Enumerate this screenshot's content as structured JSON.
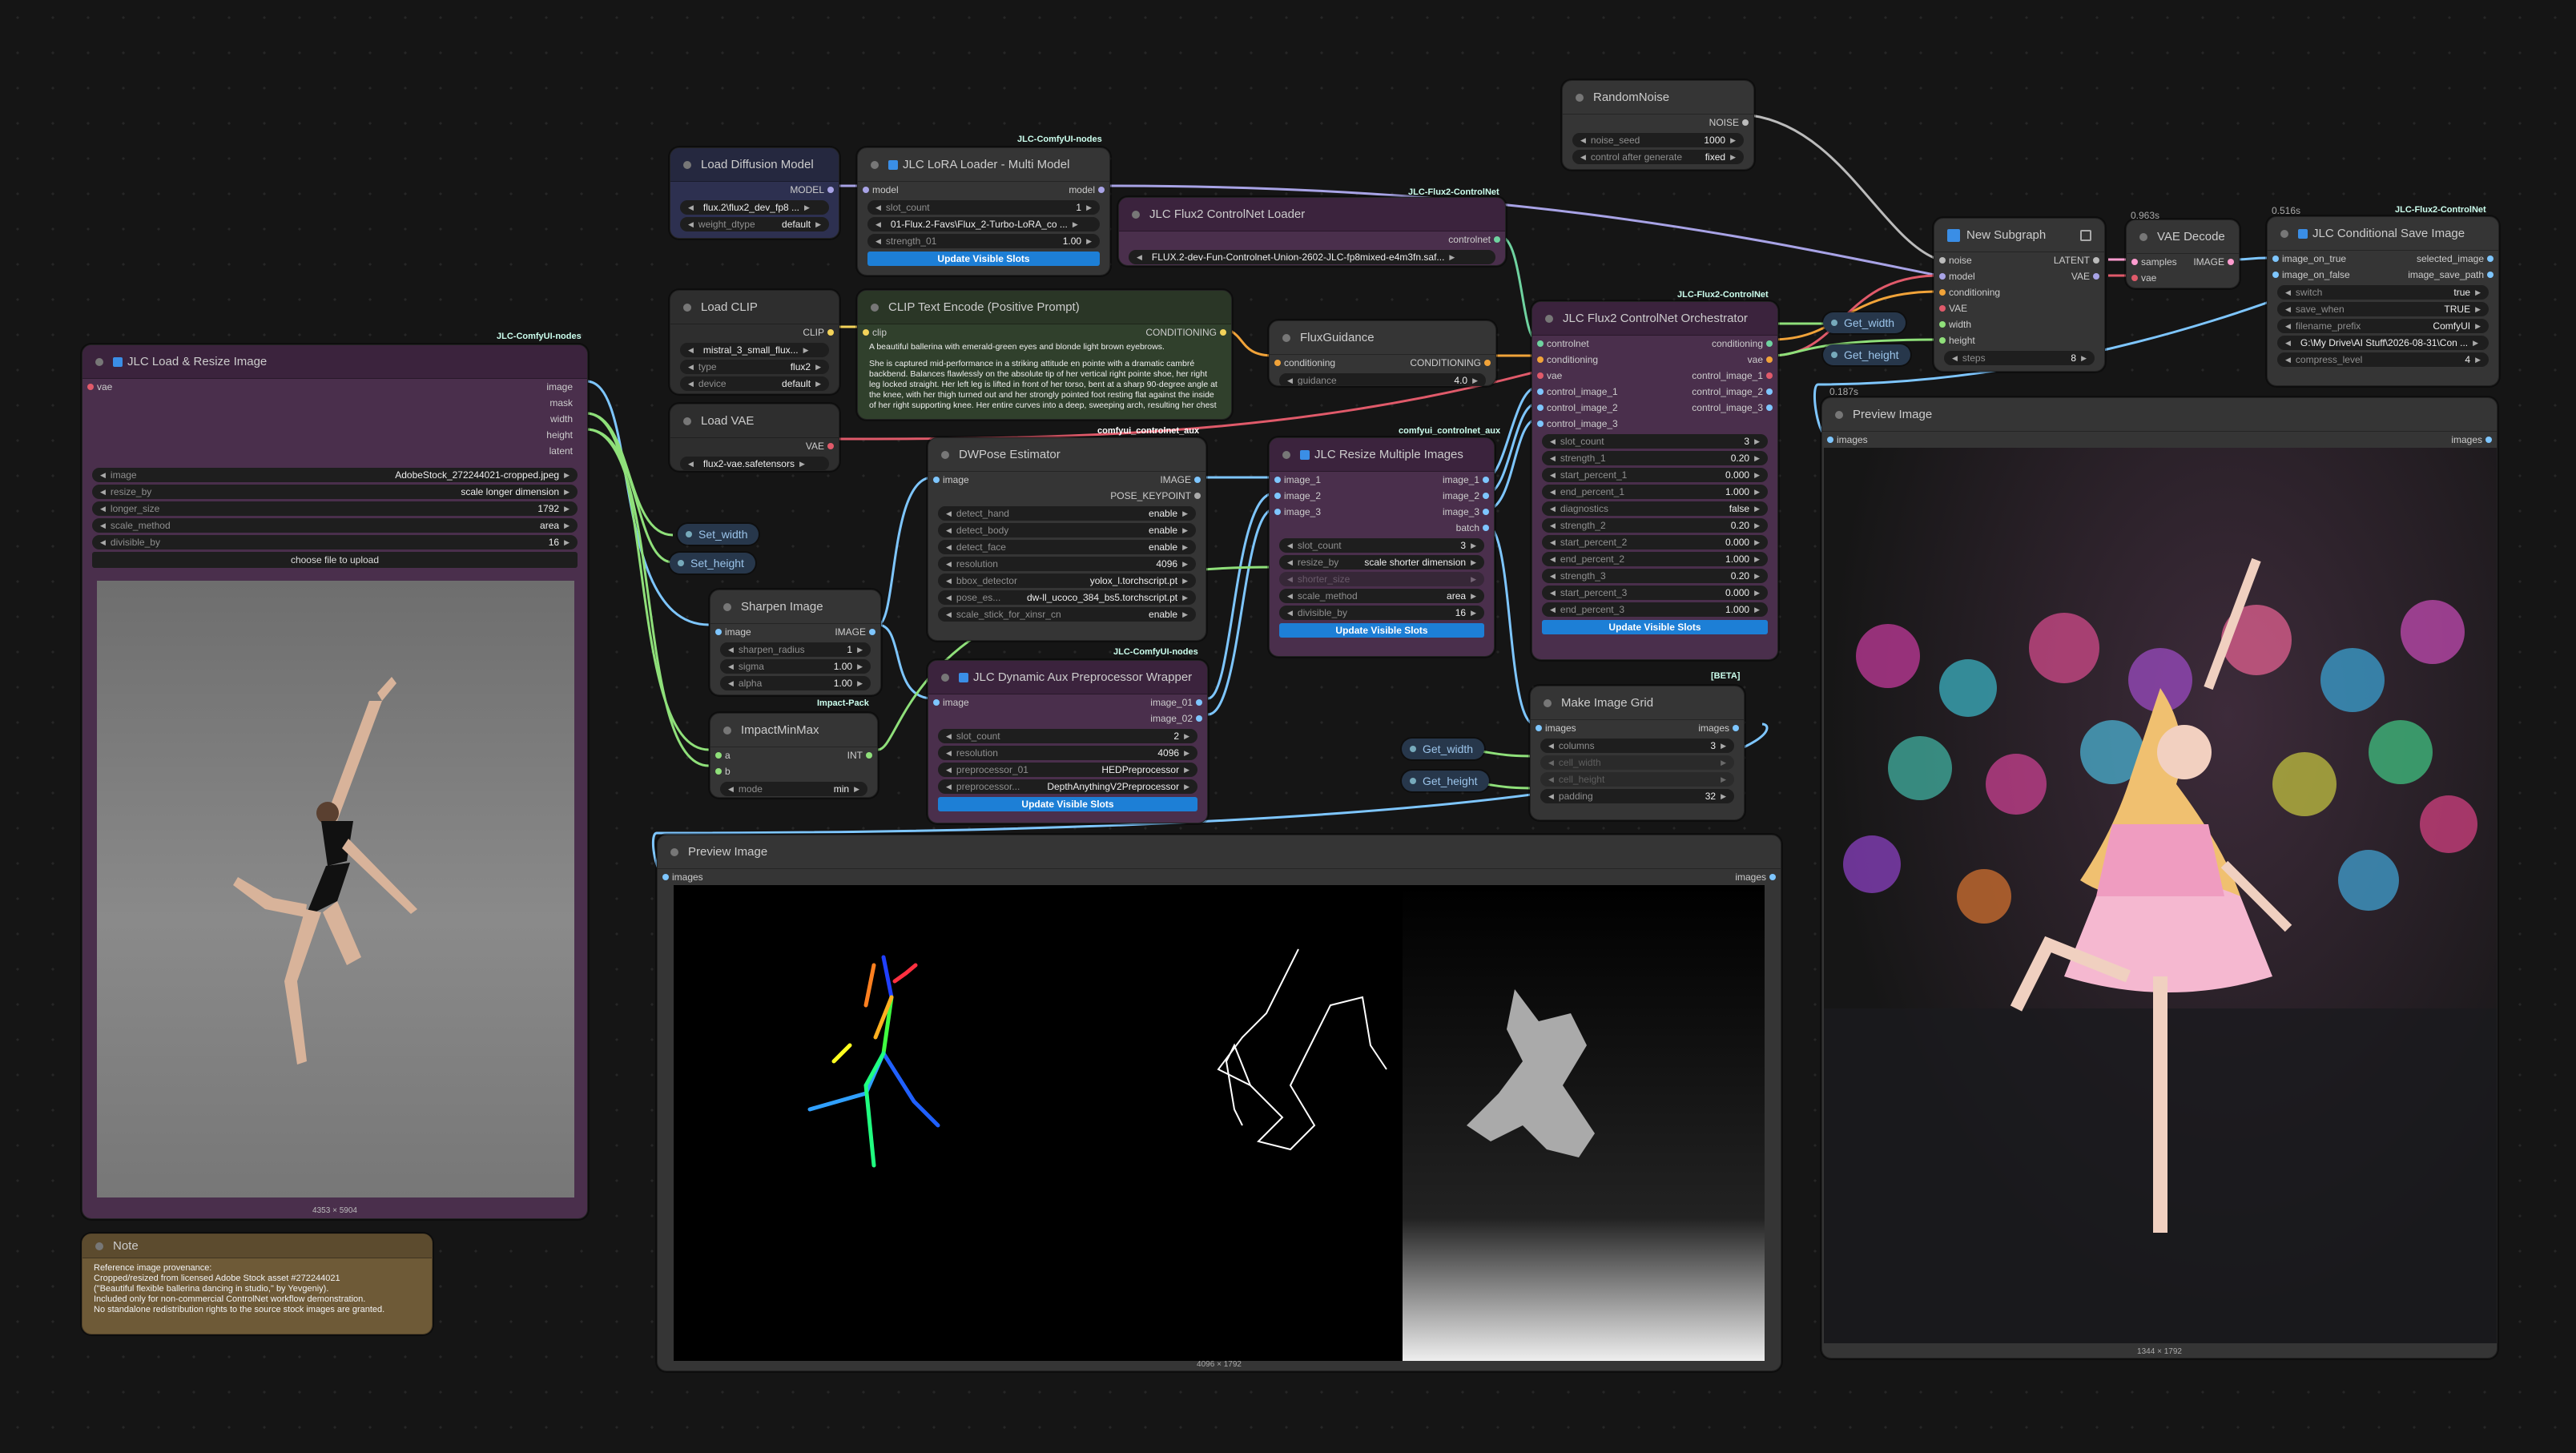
{
  "badges": {
    "jlc_nodes_1": "JLC-ComfyUI-nodes",
    "jlc_nodes_2": "JLC-ComfyUI-nodes",
    "jlc_nodes_3": "JLC-ComfyUI-nodes",
    "flux2_cn_1": "JLC-Flux2-ControlNet",
    "flux2_cn_2": "JLC-Flux2-ControlNet",
    "flux2_cn_3": "JLC-Flux2-ControlNet",
    "aux": "comfyui_controlnet_aux",
    "impact": "Impact-Pack",
    "beta": "[BETA]",
    "t1": "0.963s",
    "t2": "0.516s",
    "t3": "0.187s"
  },
  "load_resize": {
    "title": "JLC Load & Resize Image",
    "input": "vae",
    "outputs": [
      "image",
      "mask",
      "width",
      "height",
      "latent"
    ],
    "image": "AdobeStock_272244021-cropped.jpeg",
    "resize_by": "scale longer dimension",
    "longer_size": "1792",
    "scale_method": "area",
    "divisible_by": "16",
    "upload": "choose file to upload",
    "dims": "4353 × 5904",
    "labels": {
      "image": "image",
      "resize_by": "resize_by",
      "longer_size": "longer_size",
      "scale_method": "scale_method",
      "divisible_by": "divisible_by"
    }
  },
  "note": {
    "title": "Note",
    "lines": [
      "Reference image provenance:",
      "Cropped/resized from licensed Adobe Stock asset #272244021",
      "(\"Beautiful flexible ballerina dancing in studio,\" by Yevgeniy).",
      "Included only for non-commercial ControlNet workflow demonstration.",
      "No standalone redistribution rights to the source stock images are granted."
    ]
  },
  "load_diffusion": {
    "title": "Load Diffusion Model",
    "out": "MODEL",
    "unet_name": "flux.2\\flux2_dev_fp8 ...",
    "weight_dtype_label": "weight_dtype",
    "weight_dtype": "default"
  },
  "lora": {
    "title": "JLC LoRA Loader - Multi Model",
    "in": "model",
    "out": "model",
    "slot_count_label": "slot_count",
    "slot_count": "1",
    "lora": "01-Flux.2-Favs\\Flux_2-Turbo-LoRA_co ...",
    "strength_label": "strength_01",
    "strength": "1.00",
    "button": "Update Visible Slots"
  },
  "load_clip": {
    "title": "Load CLIP",
    "out": "CLIP",
    "clip_name": "mistral_3_small_flux...",
    "type_label": "type",
    "type": "flux2",
    "device_label": "device",
    "device": "default"
  },
  "load_vae": {
    "title": "Load VAE",
    "out": "VAE",
    "vae_name": "flux2-vae.safetensors"
  },
  "clip_text": {
    "title": "CLIP Text Encode (Positive Prompt)",
    "in": "clip",
    "out": "CONDITIONING",
    "text1": "A beautiful ballerina with emerald-green eyes and blonde light brown eyebrows.",
    "text2": "She is captured mid-performance in a striking attitude en pointe with a dramatic cambré backbend. Balances flawlessly on the absolute tip of her vertical right pointe shoe, her right leg locked straight. Her left leg is lifted in front of her torso, bent at a sharp 90-degree angle at the knee, with her thigh turned out and her strongly pointed foot resting flat against the inside of her right supporting knee. Her entire curves into a deep, sweeping arch, resulting her chest upward while body"
  },
  "cn_loader": {
    "title": "JLC Flux2 ControlNet Loader",
    "out": "controlnet",
    "model": "FLUX.2-dev-Fun-Controlnet-Union-2602-JLC-fp8mixed-e4m3fn.saf..."
  },
  "flux_guidance": {
    "title": "FluxGuidance",
    "in": "conditioning",
    "out": "CONDITIONING",
    "guidance_label": "guidance",
    "guidance": "4.0"
  },
  "dwpose": {
    "title": "DWPose Estimator",
    "in": "image",
    "outs": [
      "IMAGE",
      "POSE_KEYPOINT"
    ],
    "widgets": [
      {
        "label": "detect_hand",
        "value": "enable"
      },
      {
        "label": "detect_body",
        "value": "enable"
      },
      {
        "label": "detect_face",
        "value": "enable"
      },
      {
        "label": "resolution",
        "value": "4096"
      },
      {
        "label": "bbox_detector",
        "value": "yolox_l.torchscript.pt"
      },
      {
        "label": "pose_es...",
        "value": "dw-ll_ucoco_384_bs5.torchscript.pt"
      },
      {
        "label": "scale_stick_for_xinsr_cn",
        "value": "enable"
      }
    ]
  },
  "resize_multi": {
    "title": "JLC Resize Multiple Images",
    "ins": [
      "image_1",
      "image_2",
      "image_3"
    ],
    "outs": [
      "image_1",
      "image_2",
      "image_3",
      "batch"
    ],
    "widgets": [
      {
        "label": "slot_count",
        "value": "3"
      },
      {
        "label": "resize_by",
        "value": "scale shorter dimension"
      },
      {
        "label": "shorter_size",
        "value": ""
      },
      {
        "label": "scale_method",
        "value": "area"
      },
      {
        "label": "divisible_by",
        "value": "16"
      }
    ],
    "button": "Update Visible Slots"
  },
  "orchestrator": {
    "title": "JLC Flux2 ControlNet Orchestrator",
    "ins": [
      "controlnet",
      "conditioning",
      "vae",
      "control_image_1",
      "control_image_2",
      "control_image_3"
    ],
    "outs": [
      "conditioning",
      "vae",
      "control_image_1",
      "control_image_2",
      "control_image_3"
    ],
    "widgets": [
      {
        "label": "slot_count",
        "value": "3"
      },
      {
        "label": "strength_1",
        "value": "0.20"
      },
      {
        "label": "start_percent_1",
        "value": "0.000"
      },
      {
        "label": "end_percent_1",
        "value": "1.000"
      },
      {
        "label": "diagnostics",
        "value": "false"
      },
      {
        "label": "strength_2",
        "value": "0.20"
      },
      {
        "label": "start_percent_2",
        "value": "0.000"
      },
      {
        "label": "end_percent_2",
        "value": "1.000"
      },
      {
        "label": "strength_3",
        "value": "0.20"
      },
      {
        "label": "start_percent_3",
        "value": "0.000"
      },
      {
        "label": "end_percent_3",
        "value": "1.000"
      }
    ],
    "button": "Update Visible Slots"
  },
  "random_noise": {
    "title": "RandomNoise",
    "out": "NOISE",
    "seed_label": "noise_seed",
    "seed": "1000",
    "control_label": "control after generate",
    "control": "fixed"
  },
  "subgraph": {
    "title": "New Subgraph",
    "ins": [
      "noise",
      "model",
      "conditioning",
      "VAE",
      "width",
      "height"
    ],
    "outs": [
      "LATENT",
      "VAE"
    ],
    "steps_label": "steps",
    "steps": "8"
  },
  "vae_decode": {
    "title": "VAE Decode",
    "ins": [
      "samples",
      "vae"
    ],
    "out": "IMAGE"
  },
  "save": {
    "title": "JLC Conditional Save Image",
    "ins": [
      "image_on_true",
      "image_on_false"
    ],
    "outs": [
      "selected_image",
      "image_save_path"
    ],
    "switch_label": "switch",
    "switch": "true",
    "widgets": [
      {
        "label": "save_when",
        "value": "TRUE"
      },
      {
        "label": "filename_prefix",
        "value": "ComfyUI"
      },
      {
        "label": "",
        "value": "G:\\My Drive\\AI Stuff\\2026-08-31\\Con ..."
      },
      {
        "label": "compress_level",
        "value": "4"
      }
    ]
  },
  "sharpen": {
    "title": "Sharpen Image",
    "in": "image",
    "out": "IMAGE",
    "widgets": [
      {
        "label": "sharpen_radius",
        "value": "1"
      },
      {
        "label": "sigma",
        "value": "1.00"
      },
      {
        "label": "alpha",
        "value": "1.00"
      }
    ]
  },
  "minmax": {
    "title": "ImpactMinMax",
    "ins": [
      "a",
      "b"
    ],
    "out": "INT",
    "mode_label": "mode",
    "mode": "min"
  },
  "dyn_aux": {
    "title": "JLC Dynamic Aux Preprocessor Wrapper",
    "in": "image",
    "outs": [
      "image_01",
      "image_02"
    ],
    "widgets": [
      {
        "label": "slot_count",
        "value": "2"
      },
      {
        "label": "resolution",
        "value": "4096"
      },
      {
        "label": "preprocessor_01",
        "value": "HEDPreprocessor"
      },
      {
        "label": "preprocessor...",
        "value": "DepthAnythingV2Preprocessor"
      }
    ],
    "button": "Update Visible Slots"
  },
  "grid": {
    "title": "Make Image Grid",
    "in": "images",
    "out": "images",
    "widgets": [
      {
        "label": "columns",
        "value": "3"
      },
      {
        "label": "cell_width",
        "value": ""
      },
      {
        "label": "cell_height",
        "value": ""
      },
      {
        "label": "padding",
        "value": "32"
      }
    ]
  },
  "preview1": {
    "title": "Preview Image",
    "in": "images",
    "out": "images",
    "dims": "4096 × 1792"
  },
  "preview2": {
    "title": "Preview Image",
    "in": "images",
    "out": "images",
    "dims": "1344 × 1792"
  },
  "pills": {
    "set_width": "Set_width",
    "set_height": "Set_height",
    "get_width_1": "Get_width",
    "get_height_1": "Get_height",
    "get_width_2": "Get_width",
    "get_height_2": "Get_height"
  }
}
